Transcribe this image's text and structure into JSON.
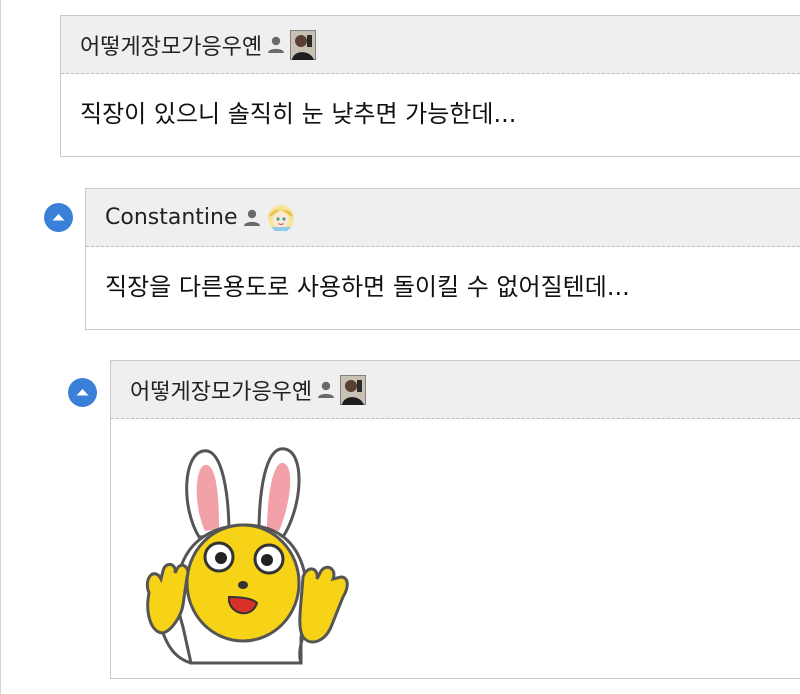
{
  "comments": [
    {
      "author": "어떻게장모가응우옌",
      "text": "직장이 있으니 솔직히 눈 낮추면 가능한데...",
      "user_icon": "person-icon",
      "avatar": "avatar-photo-man"
    },
    {
      "author": "Constantine",
      "text": "직장을 다른용도로 사용하면 돌이킬 수 없어질텐데...",
      "user_icon": "person-icon",
      "avatar": "avatar-anime-girl"
    },
    {
      "author": "어떻게장모가응우옌",
      "text": "",
      "user_icon": "person-icon",
      "avatar": "avatar-photo-man",
      "sticker": "rabbit-sticker"
    }
  ],
  "colors": {
    "header_bg": "#efefef",
    "border": "#c8c8c8",
    "toggle_blue": "#3a80d9",
    "sticker_yellow": "#f7d318"
  }
}
